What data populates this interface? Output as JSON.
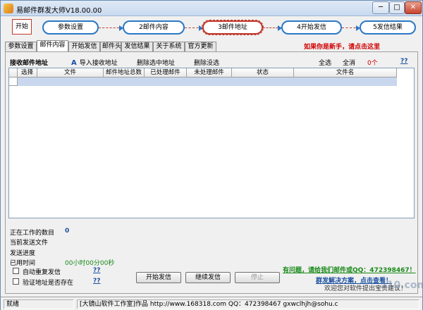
{
  "window": {
    "title": "易邮件群发大师V18.00.00",
    "controls": {
      "minimize": "─",
      "maximize": "□",
      "close": "✕"
    }
  },
  "steps": {
    "start": "开始",
    "items": [
      "参数设置",
      "2邮件内容",
      "3邮件地址",
      "4开始发信",
      "5发信结果"
    ]
  },
  "tabs": [
    "参数设置",
    "邮件内容",
    "开始发信",
    "邮件头",
    "发信结果",
    "关于系统",
    "官方更新"
  ],
  "newbie_link": "如果你是新手，请点击这里",
  "toolbar": {
    "title": "接收邮件地址",
    "import": "导入接收地址",
    "import_icon": "A",
    "delete_selected": "删除选中地址",
    "delete_unselected": "删除没选",
    "select_all": "全选",
    "all": "全消",
    "count": "0个",
    "help": "??"
  },
  "grid": {
    "columns": [
      "选择",
      "文件",
      "邮件地址总数",
      "已处理邮件",
      "未处理邮件",
      "状态",
      "文件名"
    ]
  },
  "status": {
    "workers_label": "正在工作的数目",
    "workers_value": "0",
    "current_file_label": "当前发送文件",
    "progress_label": "发送进度",
    "elapsed_label": "已用时间",
    "elapsed_value": "00小时00分00秒",
    "auto_resend_label": "自动重复发信",
    "verify_label": "验证地址是否存在",
    "help": "??"
  },
  "buttons": {
    "send": "开始发信",
    "continue": "继续发信",
    "stop": "停止"
  },
  "contact": "有问题，请给我们邮件或QQ：472398467！",
  "solution": "群发解决方案，点击查看！",
  "welcome": "欢迎您对软件提出宝贵建议！",
  "watermark": "510.com",
  "statusbar": {
    "ready": "就绪",
    "credit": "[大镜山软件工作室]作品 http://www.168318.com QQ：472398467 gxwclhjh@sohu.c"
  },
  "colors": {
    "accent_blue": "#2a78c8",
    "highlight_red": "#c0392b",
    "link_red": "#d00000",
    "link_green": "#1a8a1a",
    "selected_row": "#c8d7ee"
  }
}
